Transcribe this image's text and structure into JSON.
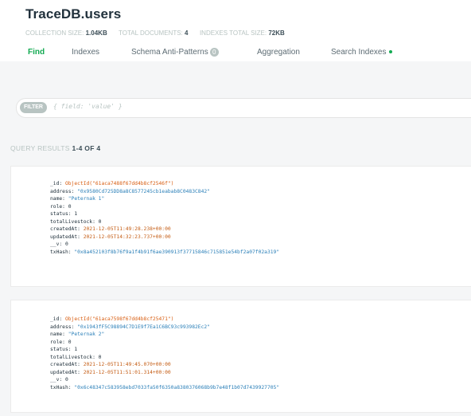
{
  "collection_title": "TraceDB.users",
  "stats": {
    "collection_size_label": "COLLECTION SIZE:",
    "collection_size_value": "1.04KB",
    "total_documents_label": "TOTAL DOCUMENTS:",
    "total_documents_value": "4",
    "indexes_size_label": "INDEXES TOTAL SIZE:",
    "indexes_size_value": "72KB"
  },
  "tabs": [
    {
      "label": "Find",
      "active": true
    },
    {
      "label": "Indexes"
    },
    {
      "label": "Schema Anti-Patterns",
      "badge": "0"
    },
    {
      "label": "Aggregation"
    },
    {
      "label": "Search Indexes"
    }
  ],
  "filter": {
    "button_label": "FILTER",
    "placeholder": "{ field: 'value' }"
  },
  "results": {
    "label": "QUERY RESULTS",
    "count": "1-4 OF 4"
  },
  "documents": [
    {
      "_id": "ObjectId(\"61aca7488f67dd4b8cf2546f\")",
      "address": "\"0x9580Cd725DD8a8C8577245cb1eabab8C0483C842\"",
      "name": "\"Peternak 1\"",
      "role": "0",
      "status": "1",
      "totalLivestock": "0",
      "createdAt": "2021-12-05T11:49:28.238+00:00",
      "updatedAt": "2021-12-05T14:32:23.737+00:00",
      "__v": "0",
      "txHash": "\"0x8a452103f8b76f9a1f4b91f6ae390913f37715846c715851e54bf2a07f02a319\""
    },
    {
      "_id": "ObjectId(\"61aca7598f67dd4b8cf25471\")",
      "address": "\"0x1943fF5C98894C7D1E9f7Ea1C6BC93c993982Ec2\"",
      "name": "\"Peternak 2\"",
      "role": "0",
      "status": "1",
      "totalLivestock": "0",
      "createdAt": "2021-12-05T11:49:45.070+00:00",
      "updatedAt": "2021-12-05T11:51:01.314+00:00",
      "__v": "0",
      "txHash": "\"0x6c48347c583958ebd7033fa50f6350a8380376068b9b7e48f1b07d7439927705\""
    }
  ],
  "field_labels": {
    "_id": "_id:",
    "address": "address:",
    "name": "name:",
    "role": "role:",
    "status": "status:",
    "totalLivestock": "totalLivestock:",
    "createdAt": "createdAt:",
    "updatedAt": "updatedAt:",
    "__v": "__v:",
    "txHash": "txHash:"
  },
  "colors": {
    "accent": "#13aa52",
    "muted": "#b8c4c2",
    "band": "#f5f6f7"
  }
}
